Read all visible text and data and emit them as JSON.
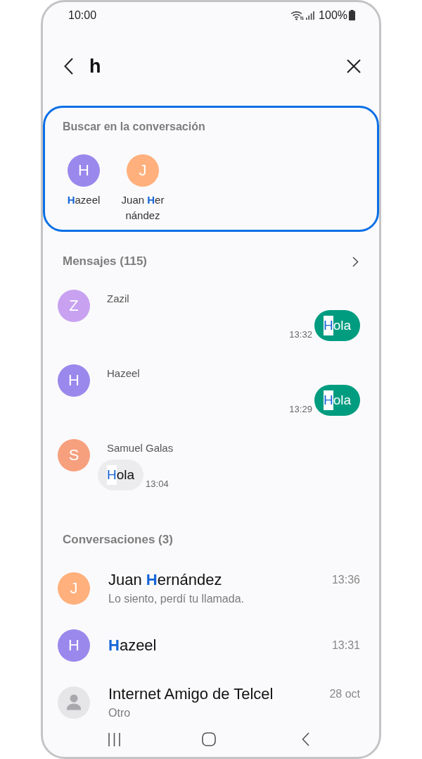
{
  "status_bar": {
    "time": "10:00",
    "battery": "100%"
  },
  "search": {
    "value": "h"
  },
  "contacts_card": {
    "title": "Buscar en la conversación",
    "contacts": [
      {
        "avatar": {
          "kind": "letter",
          "letter": "H",
          "color": "#9a88ec"
        },
        "name": [
          {
            "text": "H",
            "match": true
          },
          {
            "text": "azeel",
            "match": false
          }
        ]
      },
      {
        "avatar": {
          "kind": "letter",
          "letter": "J",
          "color": "#ffb07c"
        },
        "name": [
          {
            "text": "Juan ",
            "match": false
          },
          {
            "text": "H",
            "match": true
          },
          {
            "text": "ernández",
            "match": false
          }
        ]
      }
    ]
  },
  "messages": {
    "title": "Mensajes (115)",
    "items": [
      {
        "sender": "Zazil",
        "avatar": {
          "kind": "letter",
          "letter": "Z",
          "color": "#c8a2f0"
        },
        "kind": "sent",
        "text": [
          {
            "text": "H",
            "match": true
          },
          {
            "text": "ola",
            "match": false
          }
        ],
        "time": "13:32"
      },
      {
        "sender": "Hazeel",
        "avatar": {
          "kind": "letter",
          "letter": "H",
          "color": "#9a88ec"
        },
        "kind": "sent",
        "text": [
          {
            "text": "H",
            "match": true
          },
          {
            "text": "ola",
            "match": false
          }
        ],
        "time": "13:29"
      },
      {
        "sender": "Samuel Galas",
        "avatar": {
          "kind": "letter",
          "letter": "S",
          "color": "#f7a07e"
        },
        "kind": "received",
        "text": [
          {
            "text": "H",
            "match": true
          },
          {
            "text": "ola",
            "match": false
          }
        ],
        "time": "13:04"
      }
    ]
  },
  "conversations": {
    "title": "Conversaciones (3)",
    "items": [
      {
        "avatar": {
          "kind": "letter",
          "letter": "J",
          "color": "#ffb07c"
        },
        "name": [
          {
            "text": "Juan ",
            "match": false
          },
          {
            "text": "H",
            "match": true
          },
          {
            "text": "ernández",
            "match": false
          }
        ],
        "preview": "Lo siento, perdí tu llamada.",
        "time": "13:36"
      },
      {
        "avatar": {
          "kind": "letter",
          "letter": "H",
          "color": "#9a88ec"
        },
        "name": [
          {
            "text": "H",
            "match": true
          },
          {
            "text": "azeel",
            "match": false
          }
        ],
        "time": "13:31"
      },
      {
        "avatar": {
          "kind": "person"
        },
        "name": [
          {
            "text": "Internet Amigo de Telcel",
            "match": false
          }
        ],
        "preview": "Otro",
        "time": "28 oct"
      }
    ]
  }
}
